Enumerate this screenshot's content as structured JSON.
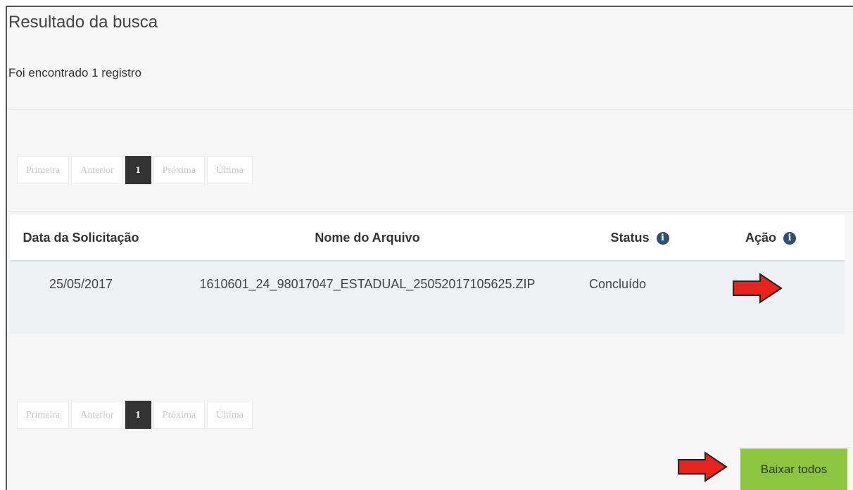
{
  "header": {
    "title": "Resultado da busca",
    "count_text": "Foi encontrado 1 registro"
  },
  "pagination": {
    "first": "Primeira",
    "prev": "Anterior",
    "current": "1",
    "next": "Próxima",
    "last": "Última"
  },
  "table": {
    "headers": {
      "date": "Data da Solicitação",
      "file": "Nome do Arquivo",
      "status": "Status",
      "action": "Ação"
    },
    "info_icon_glyph": "i",
    "rows": [
      {
        "date": "25/05/2017",
        "file": "1610601_24_98017047_ESTADUAL_25052017105625.ZIP",
        "status": "Concluído",
        "action_icon": "file-icon"
      }
    ]
  },
  "actions": {
    "download_all": "Baixar todos"
  },
  "colors": {
    "button_green": "#8cc63f",
    "active_page": "#333333",
    "arrow_red": "#e8221c",
    "icon_blue": "#2a4d75"
  }
}
